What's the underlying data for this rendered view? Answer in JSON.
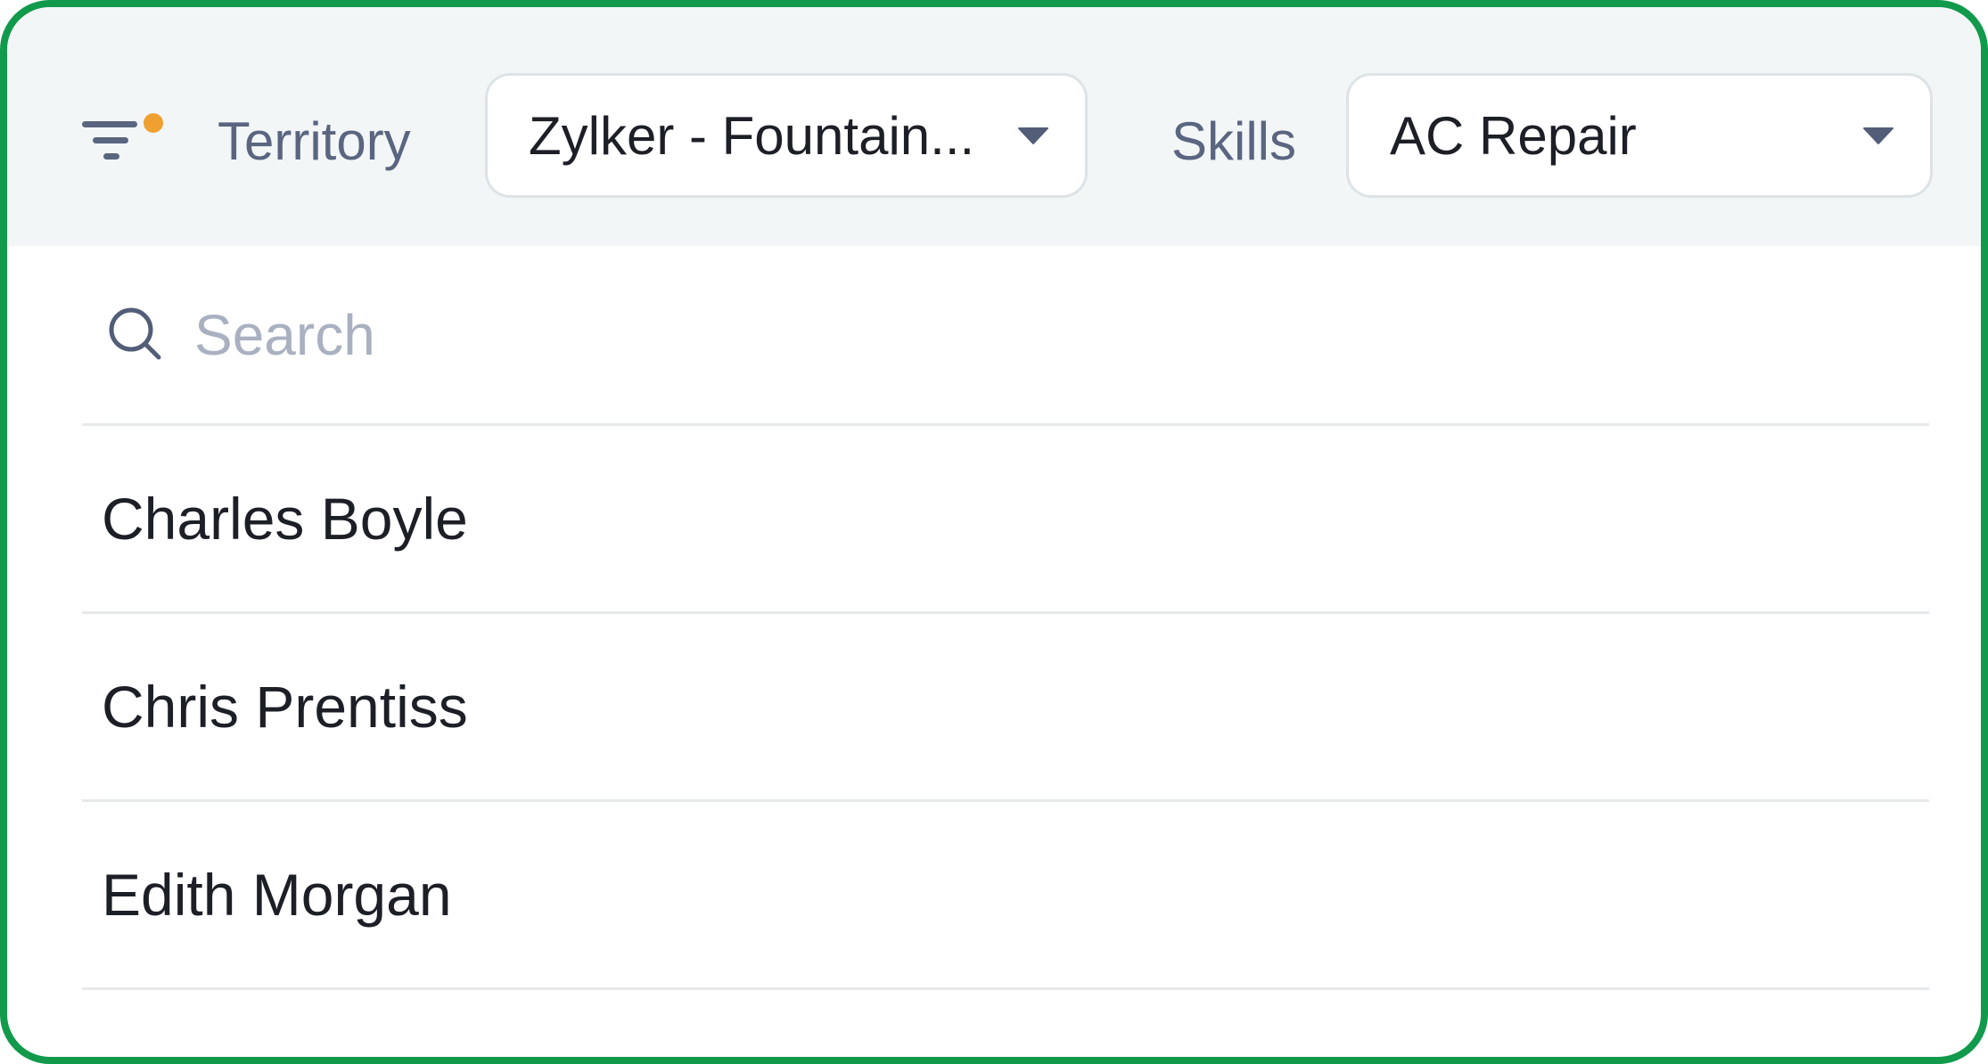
{
  "filter_bar": {
    "filter_icon": "filter-icon",
    "filter_active_dot_color": "#f0a030",
    "territory": {
      "label": "Territory",
      "value": "Zylker - Fountain..."
    },
    "skills": {
      "label": "Skills",
      "value": "AC Repair"
    }
  },
  "search": {
    "icon": "search-icon",
    "placeholder": "Search",
    "value": ""
  },
  "technicians": [
    {
      "name": "Charles Boyle"
    },
    {
      "name": "Chris Prentiss"
    },
    {
      "name": "Edith Morgan"
    }
  ],
  "colors": {
    "frame_border": "#129a4c",
    "header_bg": "#f3f6f7",
    "label_text": "#5a6680",
    "placeholder_text": "#a9b1c1"
  }
}
